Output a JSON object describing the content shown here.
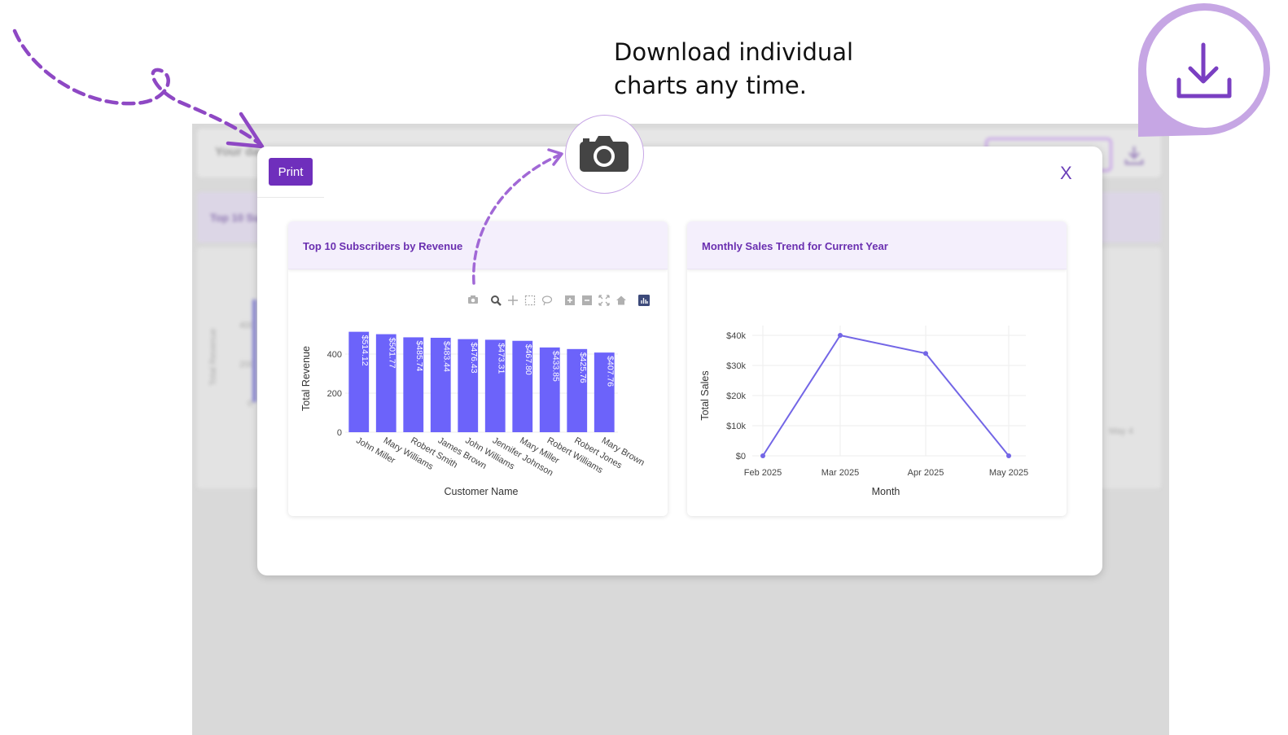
{
  "annotation": {
    "line1": "Download individual",
    "line2": "charts any time."
  },
  "background": {
    "bar_text": "Your da",
    "card_text": "Top 10 Su",
    "axis_ylabel": "Total Revenue",
    "ticks": [
      "400",
      "200",
      "0"
    ],
    "right_label": "May 4"
  },
  "modal": {
    "print_label": "Print",
    "close_label": "X",
    "left_card_title": "Top 10 Subscribers by Revenue",
    "right_card_title": "Monthly Sales Trend for Current Year"
  },
  "toolbar_icons": [
    "camera-icon",
    "zoom-icon",
    "pan-icon",
    "box-select-icon",
    "lasso-icon",
    "zoom-in-icon",
    "zoom-out-icon",
    "autoscale-icon",
    "reset-axes-icon",
    "plotly-logo-icon"
  ],
  "colors": {
    "accent": "#6f2fbc",
    "bar": "#6c63fa",
    "line": "#7366e6",
    "annotation": "#8e48c4"
  },
  "chart_data": [
    {
      "type": "bar",
      "title": "Top 10 Subscribers by Revenue",
      "xlabel": "Customer Name",
      "ylabel": "Total Revenue",
      "ylim": [
        0,
        540
      ],
      "yticks": [
        "0",
        "200",
        "400"
      ],
      "categories": [
        "John Miller",
        "Mary Williams",
        "Robert Smith",
        "James Brown",
        "John Williams",
        "Jennifer Johnson",
        "Mary Miller",
        "Robert Williams",
        "Robert Jones",
        "Mary Brown"
      ],
      "values": [
        514.12,
        501.77,
        485.74,
        483.44,
        476.43,
        473.31,
        467.8,
        433.85,
        425.76,
        407.76
      ],
      "labels": [
        "$514.12",
        "$501.77",
        "$485.74",
        "$483.44",
        "$476.43",
        "$473.31",
        "$467.80",
        "$433.85",
        "$425.76",
        "$407.76"
      ]
    },
    {
      "type": "line",
      "title": "Monthly Sales Trend for Current Year",
      "xlabel": "Month",
      "ylabel": "Total Sales",
      "ylim": [
        0,
        40000
      ],
      "yticks": [
        "$0",
        "$10k",
        "$20k",
        "$30k",
        "$40k"
      ],
      "x": [
        "Feb 2025",
        "Mar 2025",
        "Apr 2025",
        "May 2025"
      ],
      "series": [
        {
          "values": [
            0,
            40000,
            34000,
            0
          ]
        }
      ]
    }
  ]
}
